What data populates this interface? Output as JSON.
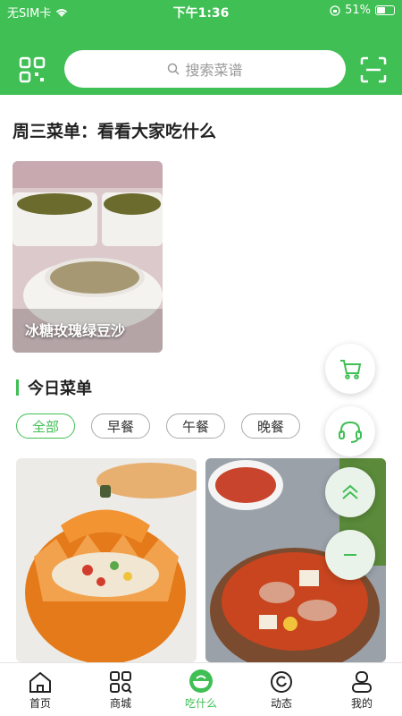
{
  "status": {
    "carrier": "无SIM卡",
    "time": "下午1:36",
    "battery": "51%"
  },
  "search": {
    "placeholder": "搜索菜谱"
  },
  "menu": {
    "title": "周三菜单：看看大家吃什么",
    "feature_caption": "冰糖玫瑰绿豆沙"
  },
  "today": {
    "title": "今日菜单",
    "chips": [
      "全部",
      "早餐",
      "午餐",
      "晚餐"
    ]
  },
  "tabs": [
    "首页",
    "商城",
    "吃什么",
    "动态",
    "我的"
  ],
  "colors": {
    "accent": "#3fbf54"
  }
}
